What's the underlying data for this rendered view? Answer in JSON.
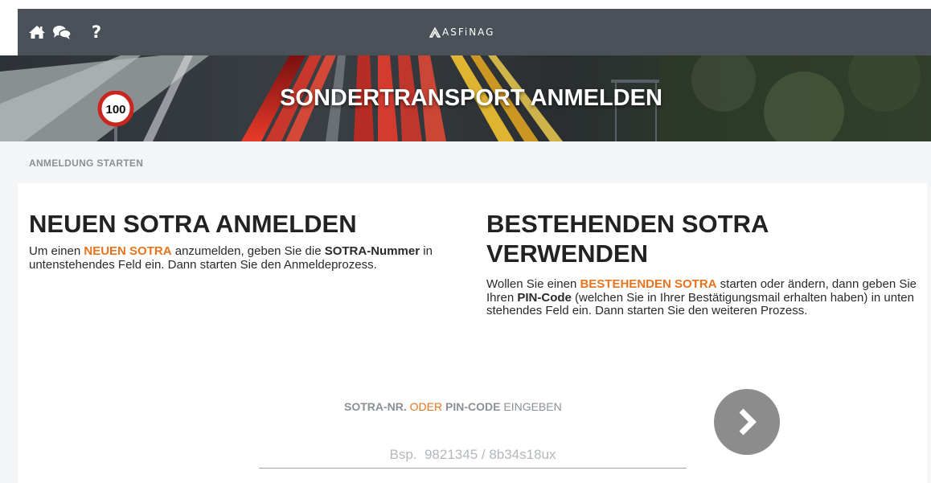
{
  "topbar": {
    "icons": [
      "home-icon",
      "chat-icon",
      "help-icon"
    ],
    "help_glyph": "?",
    "brand": "ASFiNAG"
  },
  "hero": {
    "title": "SONDERTRANSPORT ANMELDEN",
    "sign_text": "100"
  },
  "breadcrumb": {
    "label": "ANMELDUNG STARTEN"
  },
  "new_sotra": {
    "title": "NEUEN SOTRA ANMELDEN",
    "text_1": "Um einen ",
    "text_hl": "NEUEN SOTRA",
    "text_2": " anzumelden, geben Sie die ",
    "text_bold": "SOTRA-Nummer",
    "text_3": " in untenstehendes Feld ein. Dann starten Sie den Anmeldeprozess."
  },
  "existing_sotra": {
    "title_line1": "BESTEHENDEN SOTRA",
    "title_line2": "VERWENDEN",
    "text_1": "Wollen Sie einen ",
    "text_hl": "BESTEHENDEN SOTRA",
    "text_2": " starten oder ändern, dann geben Sie Ihren ",
    "text_bold": "PIN-Code",
    "text_3": " (welchen Sie in Ihrer Bestätigungsmail erhalten haben) in unten stehendes Feld ein. Dann starten Sie den weiteren Prozess."
  },
  "entry": {
    "prompt_part1": "SOTRA-NR.",
    "prompt_or": "ODER",
    "prompt_part2": "PIN-CODE",
    "prompt_part3": "EINGEBEN",
    "input_value": "",
    "input_placeholder": "Bsp.  9821345 / 8b34s18ux"
  },
  "colors": {
    "accent": "#e8731e",
    "topbar": "#4a5159",
    "background": "#f3f5f7",
    "button": "#8c8c8c"
  }
}
